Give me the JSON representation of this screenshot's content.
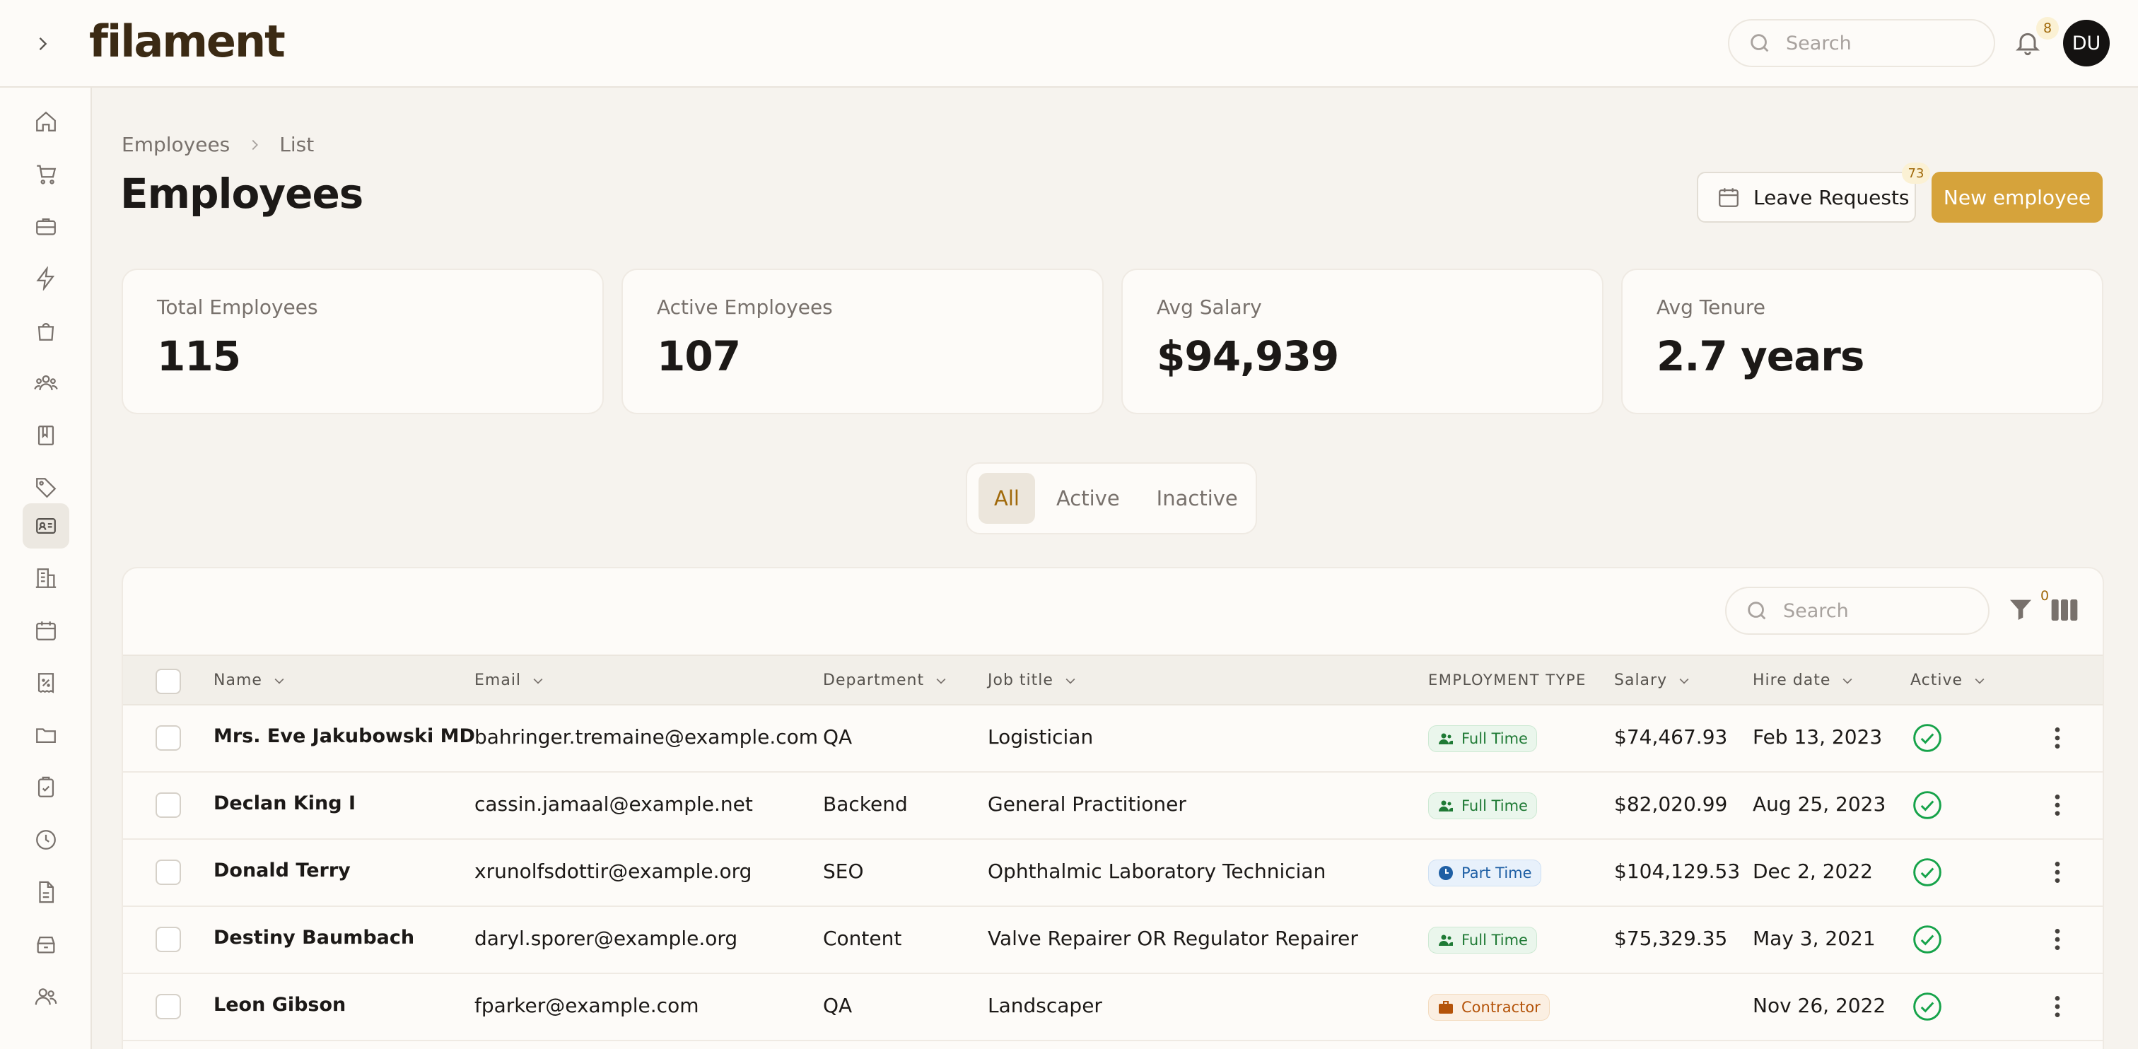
{
  "app": {
    "logo": "filament"
  },
  "topbar": {
    "search_placeholder": "Search",
    "notification_count": "8",
    "avatar_initials": "DU"
  },
  "sidebar": {
    "items": [
      {
        "icon": "home-icon"
      },
      {
        "icon": "cart-icon"
      },
      {
        "icon": "briefcase-icon"
      },
      {
        "icon": "bolt-icon"
      },
      {
        "icon": "shopping-bag-icon"
      },
      {
        "icon": "users-group-icon"
      },
      {
        "icon": "book-icon"
      },
      {
        "icon": "tag-icon"
      },
      {
        "icon": "id-card-icon",
        "active": true
      },
      {
        "icon": "building-icon"
      },
      {
        "icon": "calendar-icon"
      },
      {
        "icon": "receipt-percent-icon"
      },
      {
        "icon": "folder-icon"
      },
      {
        "icon": "clipboard-check-icon"
      },
      {
        "icon": "clock-icon"
      },
      {
        "icon": "document-icon"
      },
      {
        "icon": "archive-box-icon"
      },
      {
        "icon": "user-group-icon"
      }
    ]
  },
  "breadcrumb": {
    "parent": "Employees",
    "current": "List"
  },
  "page": {
    "title": "Employees"
  },
  "actions": {
    "leave_label": "Leave Requests",
    "leave_count": "73",
    "new_label": "New employee"
  },
  "stats": [
    {
      "label": "Total Employees",
      "value": "115"
    },
    {
      "label": "Active Employees",
      "value": "107"
    },
    {
      "label": "Avg Salary",
      "value": "$94,939"
    },
    {
      "label": "Avg Tenure",
      "value": "2.7 years"
    }
  ],
  "tabs": {
    "all": "All",
    "active": "Active",
    "inactive": "Inactive",
    "selected": "All"
  },
  "table": {
    "search_placeholder": "Search",
    "filter_count": "0",
    "columns": {
      "name": "Name",
      "email": "Email",
      "department": "Department",
      "job_title": "Job title",
      "employment_type": "EMPLOYMENT TYPE",
      "salary": "Salary",
      "hire_date": "Hire date",
      "active": "Active"
    },
    "rows": [
      {
        "name": "Mrs. Eve Jakubowski MD",
        "email": "bahringer.tremaine@example.com",
        "department": "QA",
        "job_title": "Logistician",
        "type": "Full Time",
        "salary": "$74,467.93",
        "hire_date": "Feb 13, 2023",
        "active": true
      },
      {
        "name": "Declan King I",
        "email": "cassin.jamaal@example.net",
        "department": "Backend",
        "job_title": "General Practitioner",
        "type": "Full Time",
        "salary": "$82,020.99",
        "hire_date": "Aug 25, 2023",
        "active": true
      },
      {
        "name": "Donald Terry",
        "email": "xrunolfsdottir@example.org",
        "department": "SEO",
        "job_title": "Ophthalmic Laboratory Technician",
        "type": "Part Time",
        "salary": "$104,129.53",
        "hire_date": "Dec 2, 2022",
        "active": true
      },
      {
        "name": "Destiny Baumbach",
        "email": "daryl.sporer@example.org",
        "department": "Content",
        "job_title": "Valve Repairer OR Regulator Repairer",
        "type": "Full Time",
        "salary": "$75,329.35",
        "hire_date": "May 3, 2021",
        "active": true
      },
      {
        "name": "Leon Gibson",
        "email": "fparker@example.com",
        "department": "QA",
        "job_title": "Landscaper",
        "type": "Contractor",
        "salary": "",
        "hire_date": "Nov 26, 2022",
        "active": true
      }
    ]
  },
  "colors": {
    "accent": "#d6a33b",
    "accent_text": "#a0690a",
    "success": "#16a34a"
  }
}
